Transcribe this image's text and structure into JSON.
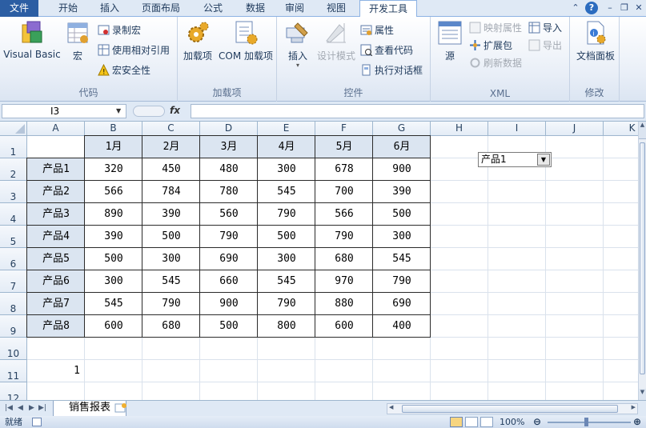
{
  "tabs": {
    "file": "文件",
    "items": [
      "开始",
      "插入",
      "页面布局",
      "公式",
      "数据",
      "审阅",
      "视图"
    ],
    "active": "开发工具"
  },
  "ribbon": {
    "code": {
      "label": "代码",
      "visual_basic": "Visual Basic",
      "macros": "宏",
      "record_macro": "录制宏",
      "relative_ref": "使用相对引用",
      "macro_security": "宏安全性"
    },
    "addins": {
      "label": "加载项",
      "addins": "加载项",
      "com_addins": "COM 加载项"
    },
    "controls": {
      "label": "控件",
      "insert": "插入",
      "design_mode": "设计模式",
      "properties": "属性",
      "view_code": "查看代码",
      "run_dialog": "执行对话框"
    },
    "xml": {
      "label": "XML",
      "source": "源",
      "map_props": "映射属性",
      "expansion": "扩展包",
      "refresh": "刷新数据",
      "import": "导入",
      "export": "导出"
    },
    "modify": {
      "label": "修改",
      "doc_panel": "文档面板"
    }
  },
  "formula_bar": {
    "name_box": "I3",
    "fx": "fx",
    "formula": ""
  },
  "grid": {
    "columns": [
      "A",
      "B",
      "C",
      "D",
      "E",
      "F",
      "G",
      "H",
      "I",
      "J",
      "K"
    ],
    "rows": [
      "1",
      "2",
      "3",
      "4",
      "5",
      "6",
      "7",
      "8",
      "9",
      "10",
      "11",
      "12"
    ],
    "header_row": [
      "1月",
      "2月",
      "3月",
      "4月",
      "5月",
      "6月"
    ],
    "table": [
      {
        "name": "产品1",
        "values": [
          "320",
          "450",
          "480",
          "300",
          "678",
          "900"
        ]
      },
      {
        "name": "产品2",
        "values": [
          "566",
          "784",
          "780",
          "545",
          "700",
          "390"
        ]
      },
      {
        "name": "产品3",
        "values": [
          "890",
          "390",
          "560",
          "790",
          "566",
          "500"
        ]
      },
      {
        "name": "产品4",
        "values": [
          "390",
          "500",
          "790",
          "500",
          "790",
          "300"
        ]
      },
      {
        "name": "产品5",
        "values": [
          "500",
          "300",
          "690",
          "300",
          "680",
          "545"
        ]
      },
      {
        "name": "产品6",
        "values": [
          "300",
          "545",
          "660",
          "545",
          "970",
          "790"
        ]
      },
      {
        "name": "产品7",
        "values": [
          "545",
          "790",
          "900",
          "790",
          "880",
          "690"
        ]
      },
      {
        "name": "产品8",
        "values": [
          "600",
          "680",
          "500",
          "800",
          "600",
          "400"
        ]
      }
    ],
    "a11": "1",
    "dropdown_value": "产品1"
  },
  "sheet": {
    "tab": "销售报表"
  },
  "status": {
    "ready": "就绪",
    "zoom": "100%"
  },
  "colors": {
    "file_tab": "#2c5ea3",
    "header_fill": "#dbe5f1",
    "ribbon_bg": "#e8eef7"
  }
}
